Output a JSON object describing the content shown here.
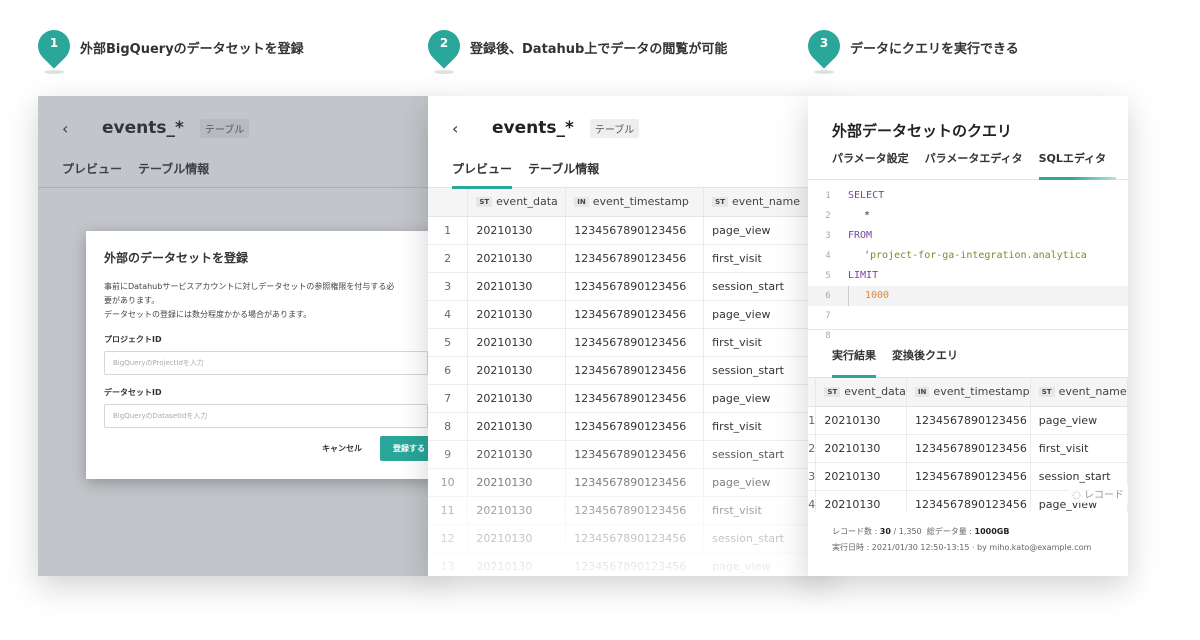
{
  "steps": [
    {
      "num": "1",
      "text": "外部BigQueryのデータセットを登録"
    },
    {
      "num": "2",
      "text": "登録後、Datahub上でデータの閲覧が可能"
    },
    {
      "num": "3",
      "text": "データにクエリを実行できる"
    }
  ],
  "panel1": {
    "back": "‹",
    "title": "events_*",
    "badge": "テーブル",
    "tabs": [
      "プレビュー",
      "テーブル情報"
    ],
    "modal": {
      "title": "外部のデータセットを登録",
      "desc_line1": "事前にDatahubサービスアカウントに対しデータセットの参照権限を付与する必",
      "desc_line2": "要があります。",
      "desc_line3": "データセットの登録には数分程度かかる場合があります。",
      "project_label": "プロジェクトID",
      "project_placeholder": "BigQueryのProjectIdを入力",
      "dataset_label": "データセットID",
      "dataset_placeholder": "BigQueryのDatasetIdを入力",
      "cancel": "キャンセル",
      "submit": "登録する"
    }
  },
  "panel2": {
    "back": "‹",
    "title": "events_*",
    "badge": "テーブル",
    "tabs": [
      "プレビュー",
      "テーブル情報"
    ],
    "columns": [
      {
        "type": "ST",
        "name": "event_data"
      },
      {
        "type": "IN",
        "name": "event_timestamp"
      },
      {
        "type": "ST",
        "name": "event_name"
      }
    ],
    "rows": [
      {
        "idx": "1",
        "date": "20210130",
        "ts": "1234567890123456",
        "name": "page_view"
      },
      {
        "idx": "2",
        "date": "20210130",
        "ts": "1234567890123456",
        "name": "first_visit"
      },
      {
        "idx": "3",
        "date": "20210130",
        "ts": "1234567890123456",
        "name": "session_start"
      },
      {
        "idx": "4",
        "date": "20210130",
        "ts": "1234567890123456",
        "name": "page_view"
      },
      {
        "idx": "5",
        "date": "20210130",
        "ts": "1234567890123456",
        "name": "first_visit"
      },
      {
        "idx": "6",
        "date": "20210130",
        "ts": "1234567890123456",
        "name": "session_start"
      },
      {
        "idx": "7",
        "date": "20210130",
        "ts": "1234567890123456",
        "name": "page_view"
      },
      {
        "idx": "8",
        "date": "20210130",
        "ts": "1234567890123456",
        "name": "first_visit"
      },
      {
        "idx": "9",
        "date": "20210130",
        "ts": "1234567890123456",
        "name": "session_start"
      },
      {
        "idx": "10",
        "date": "20210130",
        "ts": "1234567890123456",
        "name": "page_view"
      },
      {
        "idx": "11",
        "date": "20210130",
        "ts": "1234567890123456",
        "name": "first_visit"
      },
      {
        "idx": "12",
        "date": "20210130",
        "ts": "1234567890123456",
        "name": "session_start"
      },
      {
        "idx": "13",
        "date": "20210130",
        "ts": "1234567890123456",
        "name": "page_view"
      }
    ]
  },
  "panel3": {
    "title": "外部データセットのクエリ",
    "tabs": [
      "パラメータ設定",
      "パラメータエディタ",
      "SQLエディタ"
    ],
    "code": [
      {
        "n": "1",
        "text": "SELECT"
      },
      {
        "n": "2",
        "text": "*"
      },
      {
        "n": "3",
        "text": "FROM"
      },
      {
        "n": "4",
        "text": "‘project-for-ga-integration.analytica"
      },
      {
        "n": "5",
        "text": "LIMIT"
      },
      {
        "n": "6",
        "text": "1000"
      },
      {
        "n": "7",
        "text": ""
      },
      {
        "n": "8",
        "text": ""
      }
    ],
    "result_tabs": [
      "実行結果",
      "変換後クエリ"
    ],
    "columns": [
      {
        "type": "ST",
        "name": "event_data"
      },
      {
        "type": "IN",
        "name": "event_timestamp"
      },
      {
        "type": "ST",
        "name": "event_name"
      }
    ],
    "rows": [
      {
        "idx": "1",
        "date": "20210130",
        "ts": "1234567890123456",
        "name": "page_view"
      },
      {
        "idx": "2",
        "date": "20210130",
        "ts": "1234567890123456",
        "name": "first_visit"
      },
      {
        "idx": "3",
        "date": "20210130",
        "ts": "1234567890123456",
        "name": "session_start"
      },
      {
        "idx": "4",
        "date": "20210130",
        "ts": "1234567890123456",
        "name": "page_view"
      }
    ],
    "loading": "レコード",
    "meta": {
      "records_label": "レコード数 :",
      "records_value": "30",
      "records_total": "/ 1,350",
      "size_label": "総データ量 :",
      "size_value": "1000GB",
      "exec_line": "実行日時 : 2021/01/30 12:50-13:15 · by miho.kato@example.com"
    }
  },
  "colors": {
    "accent": "#2aa69a"
  }
}
